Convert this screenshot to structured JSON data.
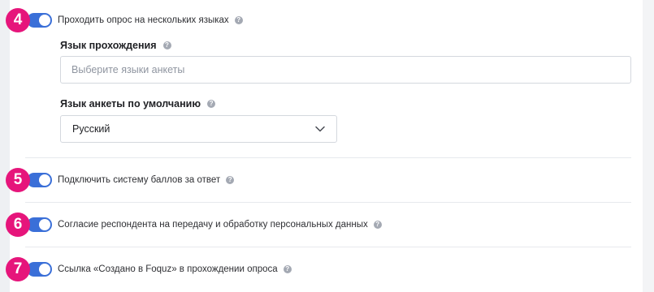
{
  "options": [
    {
      "number": "4",
      "label": "Проходить опрос на нескольких языках",
      "enabled": true
    },
    {
      "number": "5",
      "label": "Подключить систему баллов за ответ",
      "enabled": true
    },
    {
      "number": "6",
      "label": "Согласие респондента на передачу и обработку персональных данных",
      "enabled": true
    },
    {
      "number": "7",
      "label": "Ссылка «Создано в Foquz» в прохождении опроса",
      "enabled": true
    }
  ],
  "languages": {
    "label": "Язык прохождения",
    "placeholder": "Выберите языки анкеты",
    "value": ""
  },
  "default_language": {
    "label": "Язык анкеты по умолчанию",
    "value": "Русский"
  },
  "help_glyph": "?",
  "colors": {
    "badge": "#e6157b",
    "toggle_on": "#3a6fd8",
    "help_icon": "#a4a9b3"
  },
  "icons": {
    "help": "question-circle-icon",
    "select_arrow": "chevron-down-icon"
  }
}
